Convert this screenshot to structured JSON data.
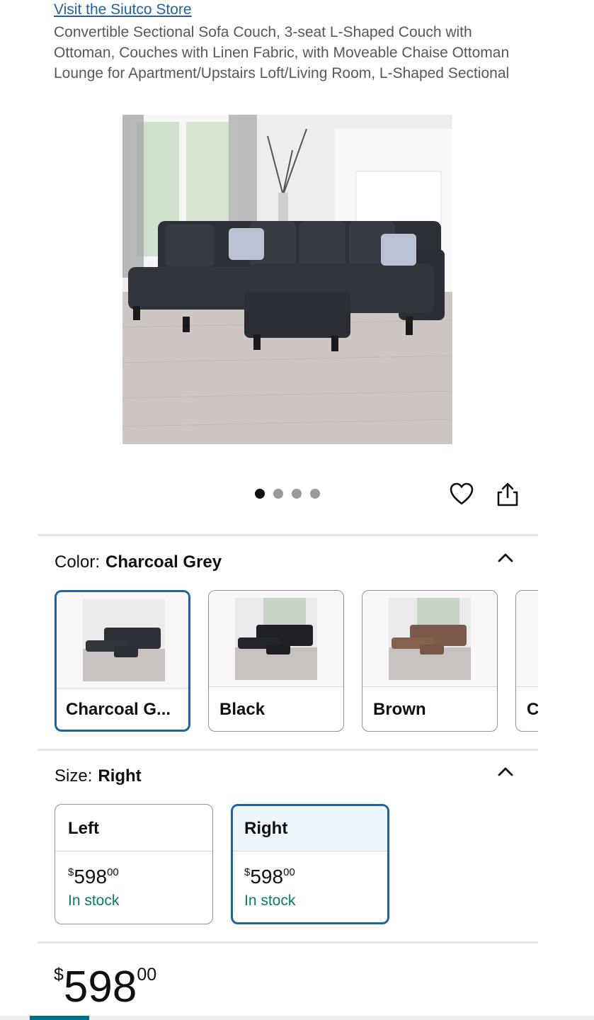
{
  "store_link": "Visit the Siutco Store",
  "product_title": "Convertible Sectional Sofa Couch, 3-seat L-Shaped Couch with Ottoman, Couches with Linen Fabric, with Moveable Chaise Ottoman Lounge for Apartment/Upstairs Loft/Living Room, L-Shaped Sectional",
  "gallery": {
    "image_count": 4,
    "active_index": 0
  },
  "icons": {
    "wishlist": "heart-icon",
    "share": "share-icon",
    "collapse": "chevron-up-icon"
  },
  "color_row": {
    "label": "Color:",
    "selected_value": "Charcoal Grey",
    "options": [
      {
        "label": "Charcoal G...",
        "selected": true
      },
      {
        "label": "Black",
        "selected": false
      },
      {
        "label": "Brown",
        "selected": false
      },
      {
        "label": "C",
        "selected": false
      }
    ]
  },
  "size_row": {
    "label": "Size:",
    "selected_value": "Right",
    "options": [
      {
        "label": "Left",
        "currency": "$",
        "price_whole": "598",
        "price_fraction": "00",
        "stock": "In stock",
        "selected": false
      },
      {
        "label": "Right",
        "currency": "$",
        "price_whole": "598",
        "price_fraction": "00",
        "stock": "In stock",
        "selected": true
      }
    ]
  },
  "price": {
    "currency": "$",
    "whole": "598",
    "fraction": "00"
  },
  "scroll_progress": 0.1,
  "colors": {
    "link": "#2162a1",
    "selected_border": "#2162a1",
    "in_stock": "#067d62",
    "progress": "#007185"
  }
}
